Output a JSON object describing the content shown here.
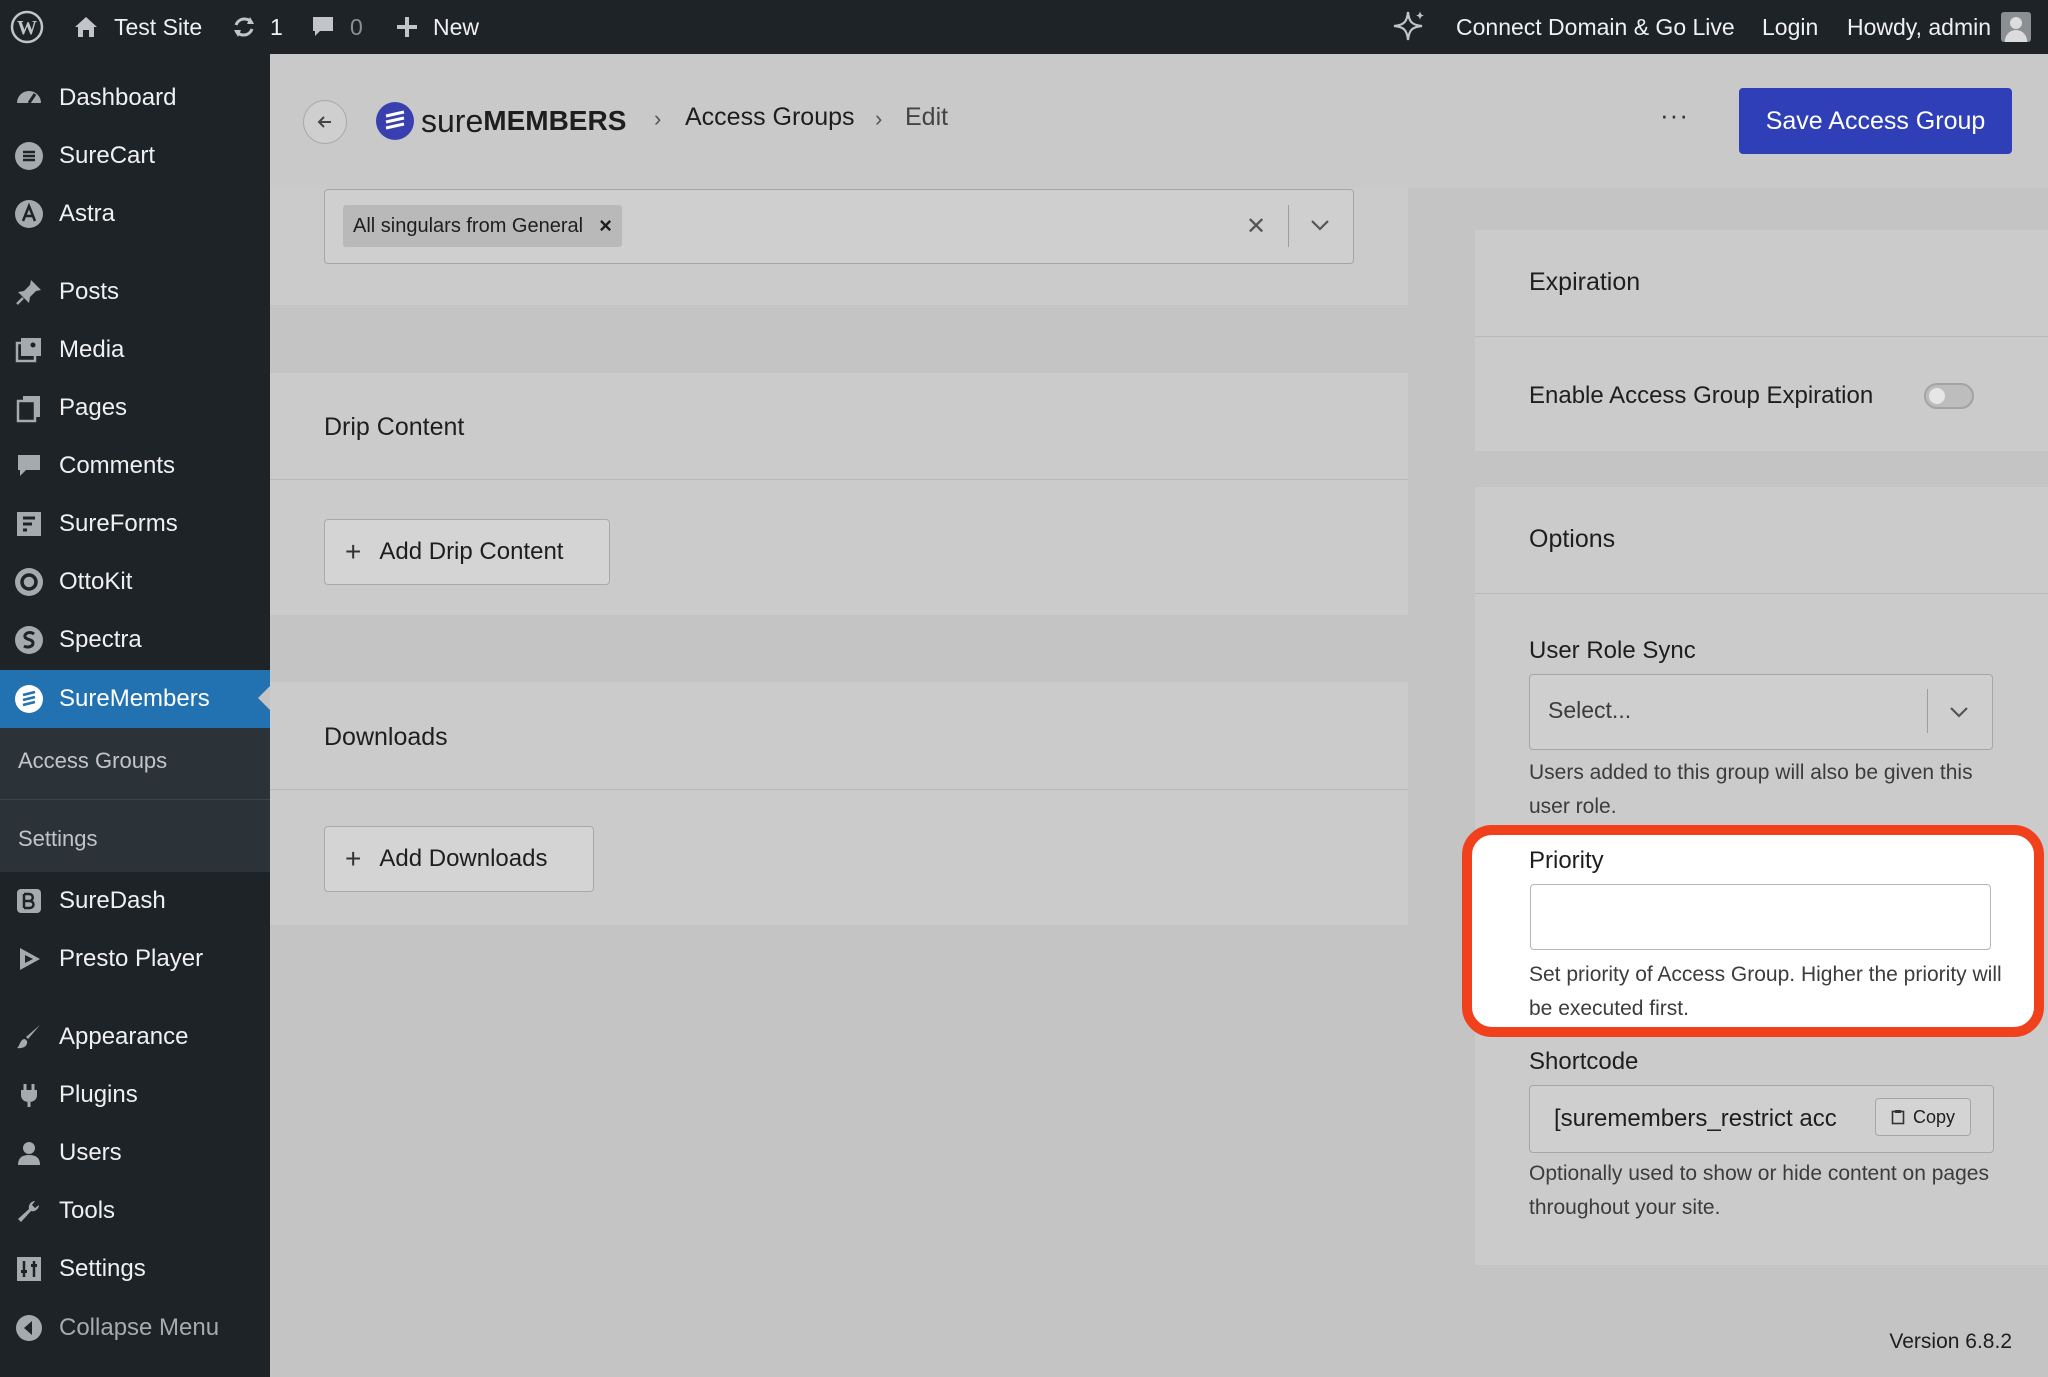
{
  "admin_bar": {
    "site_name": "Test Site",
    "updates_count": "1",
    "comments_count": "0",
    "new_label": "New",
    "connect_label": "Connect Domain & Go Live",
    "login_label": "Login",
    "howdy_label": "Howdy, admin"
  },
  "sidebar": {
    "items": [
      {
        "label": "Dashboard",
        "icon": "dashboard-icon"
      },
      {
        "label": "SureCart",
        "icon": "surecart-icon"
      },
      {
        "label": "Astra",
        "icon": "astra-icon"
      },
      {
        "label": "Posts",
        "icon": "pin-icon"
      },
      {
        "label": "Media",
        "icon": "media-icon"
      },
      {
        "label": "Pages",
        "icon": "pages-icon"
      },
      {
        "label": "Comments",
        "icon": "comment-icon"
      },
      {
        "label": "SureForms",
        "icon": "sureforms-icon"
      },
      {
        "label": "OttoKit",
        "icon": "ottokit-icon"
      },
      {
        "label": "Spectra",
        "icon": "spectra-icon"
      },
      {
        "label": "SureMembers",
        "icon": "suremembers-icon"
      },
      {
        "label": "SureDash",
        "icon": "suredash-icon"
      },
      {
        "label": "Presto Player",
        "icon": "presto-player-icon"
      },
      {
        "label": "Appearance",
        "icon": "brush-icon"
      },
      {
        "label": "Plugins",
        "icon": "plugin-icon"
      },
      {
        "label": "Users",
        "icon": "user-icon"
      },
      {
        "label": "Tools",
        "icon": "wrench-icon"
      },
      {
        "label": "Settings",
        "icon": "settings-sliders-icon"
      },
      {
        "label": "Collapse Menu",
        "icon": "collapse-icon"
      }
    ],
    "active_index": 10,
    "submenu": [
      "Access Groups",
      "Settings"
    ]
  },
  "header": {
    "logo_text_light": "sure",
    "logo_text_bold": "MEMBERS",
    "breadcrumb_1": "Access Groups",
    "breadcrumb_2": "Edit",
    "more_label": "···",
    "save_label": "Save Access Group"
  },
  "rules": {
    "selected_tag": "All singulars from General",
    "tag_remove": "×",
    "clear": "✕"
  },
  "drip": {
    "title": "Drip Content",
    "button": "Add Drip Content"
  },
  "downloads": {
    "title": "Downloads",
    "button": "Add Downloads"
  },
  "expiration": {
    "title": "Expiration",
    "toggle_label": "Enable Access Group Expiration",
    "enabled": false
  },
  "options": {
    "title": "Options",
    "role_sync_label": "User Role Sync",
    "role_sync_placeholder": "Select...",
    "role_sync_help": "Users added to this group will also be given this user role.",
    "priority_label": "Priority",
    "priority_value": "",
    "priority_help": "Set priority of Access Group. Higher the priority will be executed first.",
    "shortcode_label": "Shortcode",
    "shortcode_value": "[suremembers_restrict acc",
    "copy_label": "Copy",
    "shortcode_help": "Optionally used to show or hide content on pages throughout your site."
  },
  "footer": {
    "version": "Version 6.8.2"
  },
  "colors": {
    "admin_dark": "#1d2327",
    "active_blue": "#2271b1",
    "save_button": "#2f3fb8",
    "highlight": "#f0401c"
  }
}
